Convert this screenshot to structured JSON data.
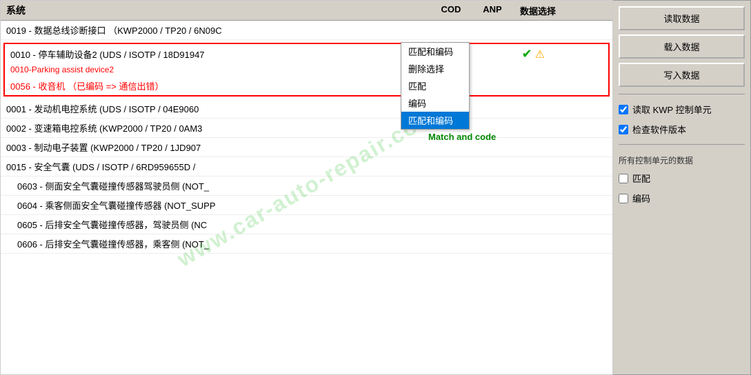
{
  "header": {
    "title": "系统",
    "col_cod": "COD",
    "col_anp": "ANP",
    "col_data": "数据选择"
  },
  "buttons": {
    "read_data": "读取数据",
    "load_data": "载入数据",
    "write_data": "写入数据"
  },
  "checkboxes": {
    "read_kwp": "读取 KWP 控制单元",
    "check_software": "检查软件版本",
    "all_control_label": "所有控制单元的数据",
    "match": "匹配",
    "encode": "编码"
  },
  "highlight_items": [
    {
      "code": "0010",
      "text": "0010 - 停车辅助设备2  (UDS / ISOTP / 18D91947",
      "has_check": true,
      "has_warn": true,
      "subtitle": "0010-Parking assist device2"
    },
    {
      "code": "0056",
      "text": "0056 - 收音机  （已编码 => 通信出错）",
      "is_red": true
    }
  ],
  "list_items": [
    {
      "text": "0019 - 数据总线诊断接口  （KWP2000 / TP20 / 6N09C"
    },
    {
      "text": "0001 - 发动机电控系统  (UDS / ISOTP / 04E9060"
    },
    {
      "text": "0002 - 变速箱电控系统  (KWP2000 / TP20 / 0AM3"
    },
    {
      "text": "0003 - 制动电子装置  (KWP2000 / TP20 / 1JD907"
    },
    {
      "text": "0015 - 安全气囊  (UDS / ISOTP / 6RD959655D /"
    },
    {
      "text": "0603 - 侧面安全气囊碰撞传感器驾驶员侧 (NOT_"
    },
    {
      "text": "0604 - 乘客侧面安全气囊碰撞传感器 (NOT_SUPP"
    },
    {
      "text": "0605 - 后排安全气囊碰撞传感器，驾驶员侧 (NC"
    },
    {
      "text": "0606 - 后排安全气囊碰撞传感器，乘客侧 (NOT_"
    }
  ],
  "dropdown": {
    "items": [
      {
        "label": "匹配和编码",
        "selected": false
      },
      {
        "label": "删除选择",
        "selected": false
      },
      {
        "label": "匹配",
        "selected": false
      },
      {
        "label": "编码",
        "selected": false
      },
      {
        "label": "匹配和编码",
        "selected": true
      }
    ]
  },
  "tooltip": "Match and code",
  "watermark": "www.car-auto-repair.com"
}
